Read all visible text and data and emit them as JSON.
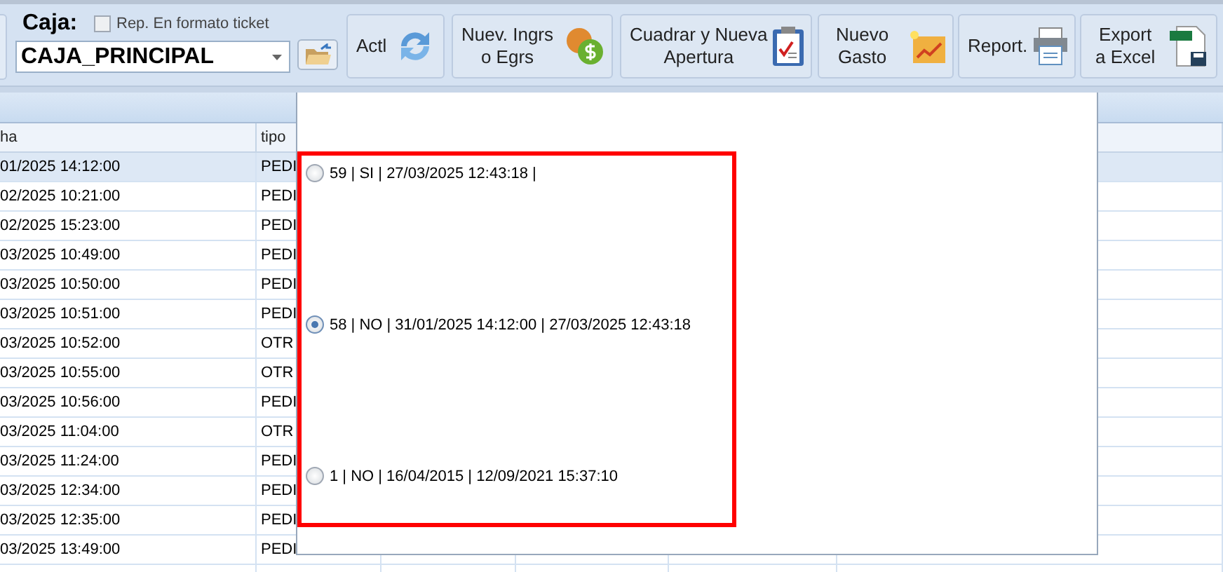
{
  "toolbar": {
    "caja_label": "Caja:",
    "ticket_checkbox": {
      "label": "Rep. En formato ticket",
      "checked": false
    },
    "caja_select": {
      "value": "CAJA_PRINCIPAL"
    },
    "buttons": [
      {
        "label": "Actl",
        "kind": "refresh"
      },
      {
        "label": "Nuev. Ingrs\no Egrs",
        "kind": "coins"
      },
      {
        "label": "Cuadrar y Nueva\nApertura",
        "kind": "clipboard"
      },
      {
        "label": "Nuevo\nGasto",
        "kind": "chart"
      },
      {
        "label": "Report.",
        "kind": "printer"
      },
      {
        "label": "Export\na Excel",
        "kind": "excel"
      }
    ]
  },
  "table": {
    "columns": [
      "ha",
      "tipo"
    ],
    "rows": [
      {
        "cells": [
          "01/2025 14:12:00",
          "PEDI"
        ],
        "selected": true
      },
      {
        "cells": [
          "02/2025 10:21:00",
          "PEDI"
        ],
        "selected": false
      },
      {
        "cells": [
          "02/2025 15:23:00",
          "PEDI"
        ],
        "selected": false
      },
      {
        "cells": [
          "03/2025 10:49:00",
          "PEDI"
        ],
        "selected": false
      },
      {
        "cells": [
          "03/2025 10:50:00",
          "PEDI"
        ],
        "selected": false
      },
      {
        "cells": [
          "03/2025 10:51:00",
          "PEDI"
        ],
        "selected": false
      },
      {
        "cells": [
          "03/2025 10:52:00",
          "OTR"
        ],
        "selected": false
      },
      {
        "cells": [
          "03/2025 10:55:00",
          "OTR"
        ],
        "selected": false
      },
      {
        "cells": [
          "03/2025 10:56:00",
          "PEDI"
        ],
        "selected": false
      },
      {
        "cells": [
          "03/2025 11:04:00",
          "OTR"
        ],
        "selected": false
      },
      {
        "cells": [
          "03/2025 11:24:00",
          "PEDI"
        ],
        "selected": false
      },
      {
        "cells": [
          "03/2025 12:34:00",
          "PEDI"
        ],
        "selected": false
      },
      {
        "cells": [
          "03/2025 12:35:00",
          "PEDI"
        ],
        "selected": false
      },
      {
        "cells": [
          "03/2025 13:49:00",
          "PEDI"
        ],
        "selected": false
      }
    ]
  },
  "popup": {
    "options": [
      {
        "label": "59 | SI | 27/03/2025 12:43:18 |",
        "selected": false
      },
      {
        "label": "58 | NO | 31/01/2025 14:12:00 | 27/03/2025 12:43:18",
        "selected": true
      },
      {
        "label": "1 | NO | 16/04/2015 | 12/09/2021 15:37:10",
        "selected": false
      }
    ]
  }
}
